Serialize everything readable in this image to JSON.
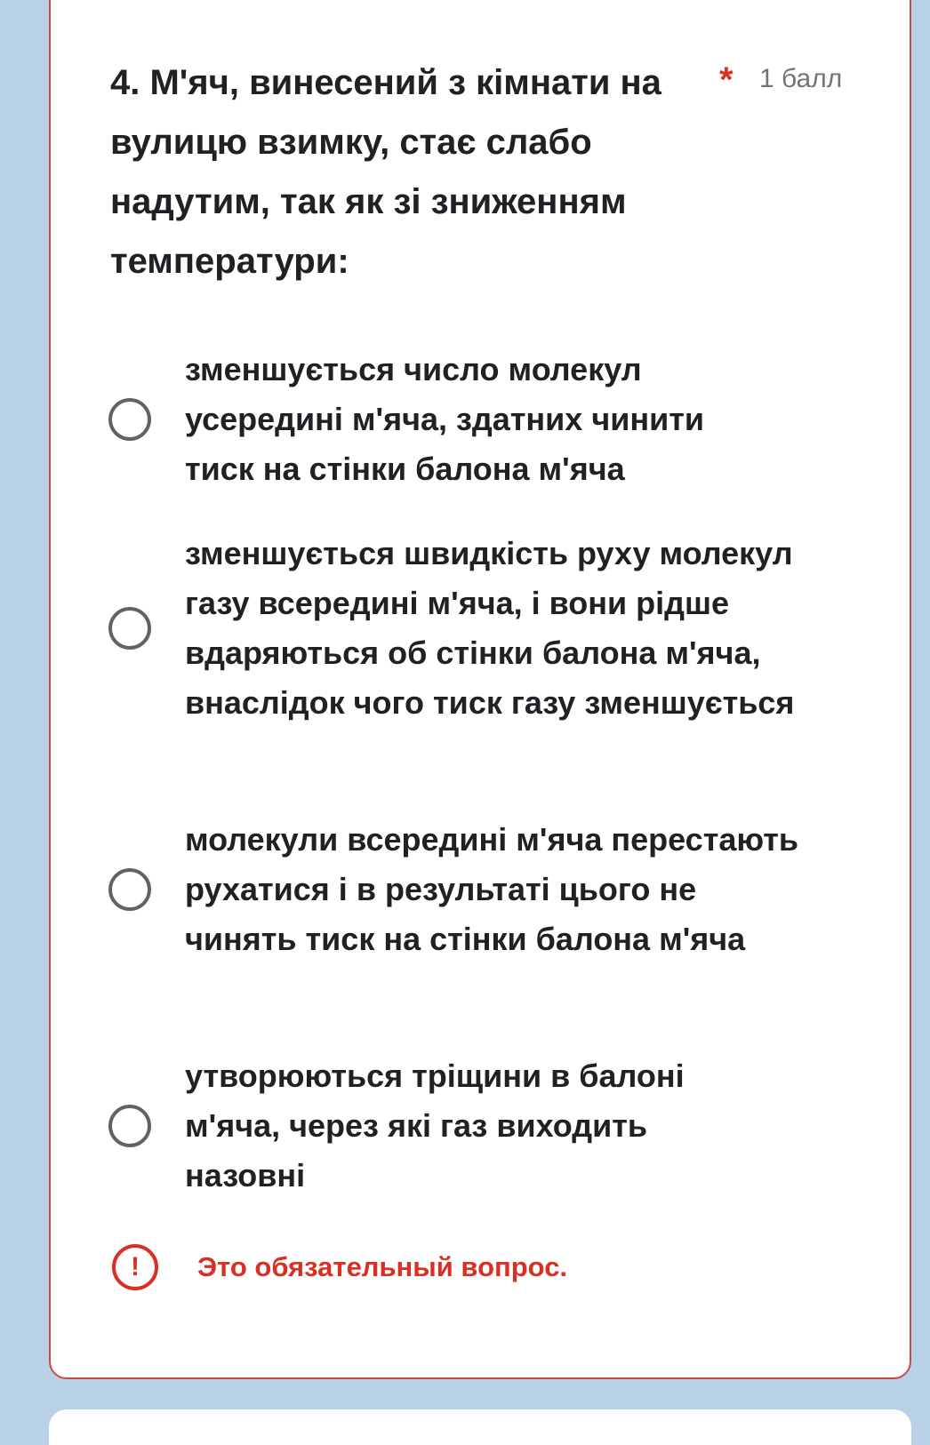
{
  "question": {
    "title": "4. М'яч, винесений з кімнати на вулицю взимку, стає слабо надутим, так як зі зниженням температури:",
    "required_marker": "*",
    "points": "1 балл"
  },
  "options": [
    {
      "label": "зменшується число молекул усередині м'яча, здатних чинити тиск на стінки балона м'яча"
    },
    {
      "label": "зменшується швидкість руху молекул газу всередині м'яча, і вони рідше вдаряються об стінки балона м'яча, внаслідок чого тиск газу зменшується"
    },
    {
      "label": "молекули всередині м'яча перестають рухатися і в результаті цього не чинять тиск на стінки балона м'яча"
    },
    {
      "label": "утворюються тріщини в балоні м'яча, через які газ виходить назовні"
    }
  ],
  "error": {
    "icon": "!",
    "icon_name": "error-icon",
    "text": "Это обязательный вопрос."
  },
  "colors": {
    "background": "#b8d1e6",
    "card_border": "#c94a44",
    "error": "#d93025",
    "radio": "#5f6368",
    "text": "#202124"
  }
}
